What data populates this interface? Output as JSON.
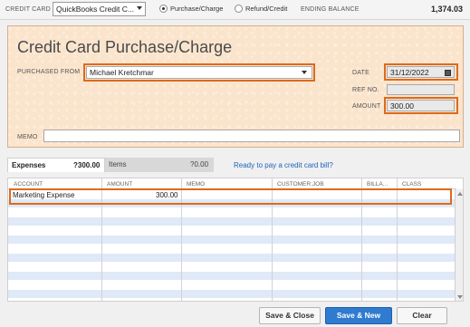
{
  "top_bar": {
    "credit_card_label": "CREDIT CARD",
    "credit_card_value": "QuickBooks Credit C...",
    "purchase_label": "Purchase/Charge",
    "refund_label": "Refund/Credit",
    "ending_balance_label": "ENDING BALANCE",
    "ending_balance_value": "1,374.03"
  },
  "form": {
    "title": "Credit Card Purchase/Charge",
    "purchased_from_label": "PURCHASED FROM",
    "purchased_from_value": "Michael Kretchmar",
    "date_label": "DATE",
    "date_value": "31/12/2022",
    "ref_no_label": "REF NO.",
    "ref_no_value": "",
    "amount_label": "AMOUNT",
    "amount_value": "300.00",
    "memo_label": "MEMO",
    "memo_value": ""
  },
  "tabs": [
    {
      "label": "Expenses",
      "amount": "?300.00"
    },
    {
      "label": "Items",
      "amount": "?0.00"
    }
  ],
  "pay_link": "Ready to pay a credit card bill?",
  "grid": {
    "headers": [
      "ACCOUNT",
      "AMOUNT",
      "MEMO",
      "CUSTOMER:JOB",
      "BILLA...",
      "CLASS"
    ],
    "rows": [
      {
        "account": "Marketing Expense",
        "amount": "300.00",
        "memo": "",
        "customer_job": "",
        "billable": "",
        "class": ""
      }
    ]
  },
  "buttons": {
    "save_close": "Save & Close",
    "save_new": "Save & New",
    "clear": "Clear"
  },
  "colors": {
    "highlight": "#de6a1c",
    "form_bg": "#fbe4cc",
    "row_alt": "#dfe9f7",
    "primary_button": "#2e7bd0",
    "link": "#1d63b8"
  }
}
